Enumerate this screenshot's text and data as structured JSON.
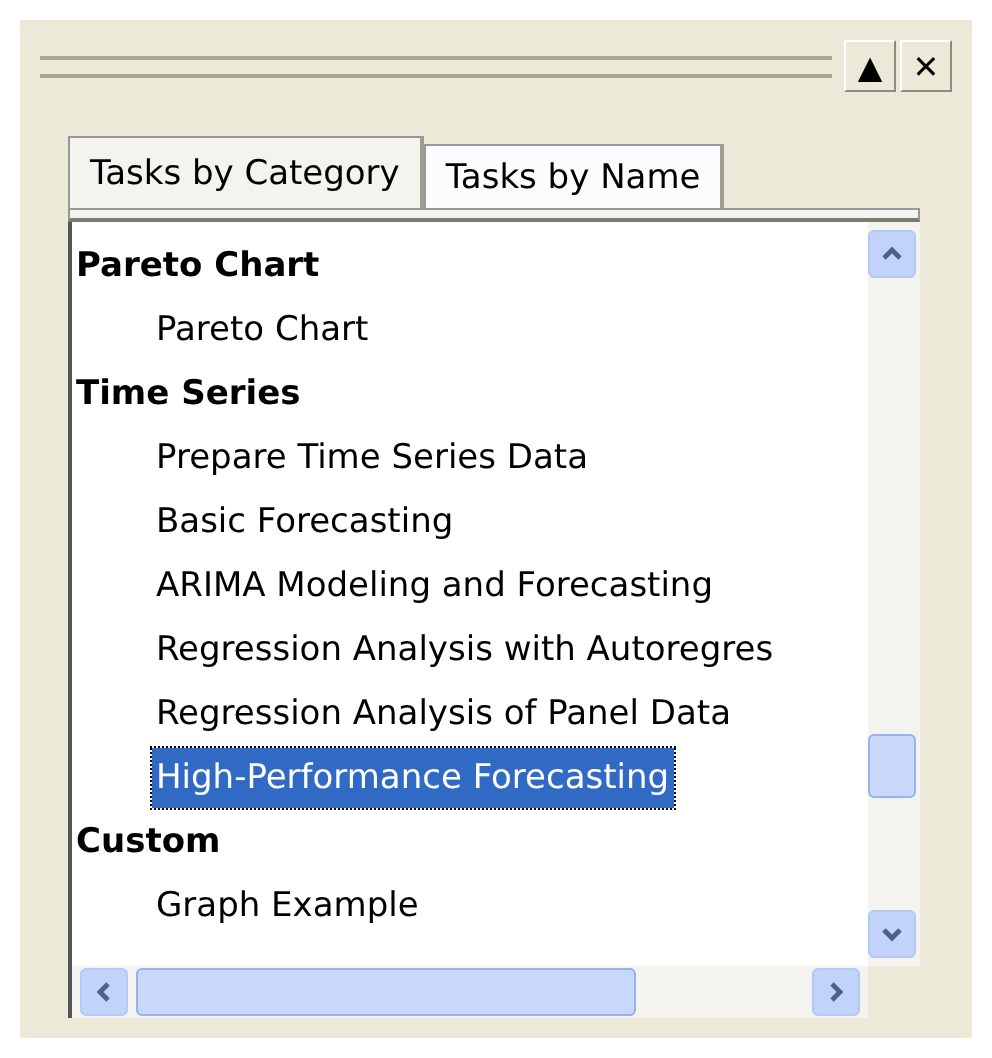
{
  "title_buttons": [
    "▲",
    "✕"
  ],
  "tabs": [
    {
      "label": "Tasks by Category",
      "selected": true
    },
    {
      "label": "Tasks by Name",
      "selected": false
    }
  ],
  "tree": [
    {
      "label": "Pareto Chart",
      "children": [
        {
          "label": "Pareto Chart",
          "selected": false
        }
      ]
    },
    {
      "label": "Time Series",
      "children": [
        {
          "label": "Prepare Time Series Data",
          "selected": false
        },
        {
          "label": "Basic Forecasting",
          "selected": false
        },
        {
          "label": "ARIMA Modeling and Forecasting",
          "selected": false
        },
        {
          "label": "Regression Analysis with Autoregres",
          "selected": false
        },
        {
          "label": "Regression Analysis of Panel Data",
          "selected": false
        },
        {
          "label": "High-Performance Forecasting",
          "selected": true
        }
      ]
    },
    {
      "label": "Custom",
      "children": [
        {
          "label": "Graph Example",
          "selected": false
        }
      ]
    }
  ]
}
